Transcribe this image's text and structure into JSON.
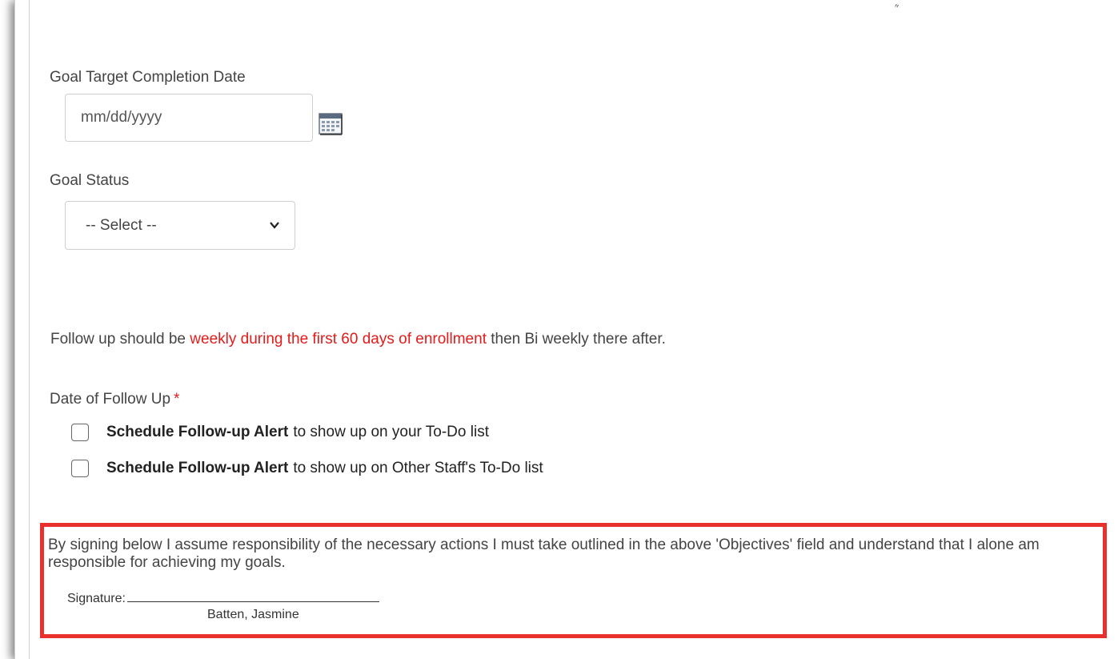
{
  "form": {
    "target_date": {
      "label": "Goal Target Completion Date",
      "placeholder": "mm/dd/yyyy",
      "icon": "calendar-icon"
    },
    "goal_status": {
      "label": "Goal Status",
      "selected": "-- Select --",
      "icon": "chevron-down-icon"
    },
    "follow_up_note": {
      "prefix": "Follow up should be",
      "highlight": "weekly during the first 60 days of enrollment",
      "suffix": "then Bi weekly there after.",
      "highlight_color": "#e31b1b"
    },
    "follow_up_date": {
      "label": "Date of Follow Up",
      "required_marker": "*",
      "options": [
        {
          "bold": "Schedule Follow-up Alert",
          "text": "to show up on your To-Do list"
        },
        {
          "bold": "Schedule Follow-up Alert",
          "text": "to show up on Other Staff's To-Do list"
        }
      ]
    }
  },
  "signature": {
    "statement": "By signing below I assume responsibility of the necessary actions I must take outlined in the above 'Objectives' field and understand that I alone am responsible for achieving my goals.",
    "label": "Signature:",
    "name": "Batten, Jasmine",
    "highlight_border_color": "#e8312c"
  }
}
